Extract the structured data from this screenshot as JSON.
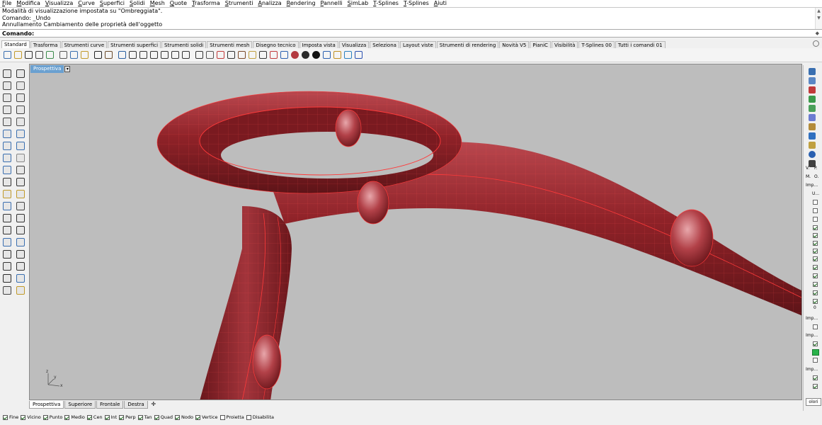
{
  "menu": [
    "File",
    "Modifica",
    "Visualizza",
    "Curve",
    "Superfici",
    "Solidi",
    "Mesh",
    "Quote",
    "Trasforma",
    "Strumenti",
    "Analizza",
    "Rendering",
    "Pannelli",
    "SimLab",
    "T-Splines",
    "T-Splines",
    "Aiuti"
  ],
  "history": [
    "Modalità di visualizzazione impostata su \"Ombreggiata\".",
    "Comando: _Undo",
    "Annullamento Cambiamento delle proprietà dell'oggetto"
  ],
  "command": {
    "label": "Comando:",
    "value": ""
  },
  "tabs": [
    "Standard",
    "Trasforma",
    "Strumenti curve",
    "Strumenti superfici",
    "Strumenti solidi",
    "Strumenti mesh",
    "Disegno tecnico",
    "Imposta vista",
    "Visualizza",
    "Seleziona",
    "Layout viste",
    "Strumenti di rendering",
    "Novità V5",
    "PianiC",
    "Visibilità",
    "T-Splines 00",
    "Tutti i comandi 01"
  ],
  "active_tab": "Standard",
  "toolbar_icons": [
    "new-file-icon",
    "open-file-icon",
    "save-icon",
    "print-icon",
    "import-icon",
    "cut-icon",
    "copy-icon",
    "paste-icon",
    "undo-icon",
    "pan-hand-icon",
    "rotate-view-icon",
    "zoom-icon",
    "zoom-window-icon",
    "zoom-extents-icon",
    "zoom-selected-icon",
    "zoom-all-icon",
    "four-views-icon",
    "cplane-icon",
    "show-icon",
    "hide-icon",
    "lock-icon",
    "layer-icon",
    "light-icon",
    "lock-object-icon",
    "material-icon",
    "render-icon",
    "rendered-sphere-icon",
    "shaded-sphere-icon",
    "dark-sphere-icon",
    "object-props-icon",
    "options-gear-icon",
    "grid-snap-icon",
    "help-icon"
  ],
  "left_tools": [
    "select-arrow-icon",
    "point-icon",
    "polyline-icon",
    "curve-control-icon",
    "circle-icon",
    "arc-icon",
    "rectangle-icon",
    "polygon-icon",
    "ellipse-icon",
    "free-curve-icon",
    "surface-corners-icon",
    "surface-edge-icon",
    "sphere-solid-icon",
    "box-solid-icon",
    "mesh-icon",
    "mesh-sphere-icon",
    "offset-icon",
    "fillet-icon",
    "trim-icon",
    "split-icon",
    "boolean-union-icon",
    "boolean-diff-icon",
    "explode-icon",
    "join-icon",
    "move-icon",
    "scale-icon",
    "array-icon",
    "mirror-icon",
    "group-icon",
    "ungroup-icon",
    "dimension-icon",
    "dimension-angle-icon",
    "block-icon",
    "text-icon",
    "check-icon",
    "analyze-icon",
    "render-light-icon",
    "paint-icon"
  ],
  "viewport": {
    "name": "Prospettiva",
    "axis_z": "z",
    "axis_y": "y",
    "axis_x": "x"
  },
  "viewport_tabs": [
    "Prospettiva",
    "Superiore",
    "Frontale",
    "Destra"
  ],
  "osnaps": [
    {
      "label": "Fine",
      "on": true
    },
    {
      "label": "Vicino",
      "on": true
    },
    {
      "label": "Punto",
      "on": true
    },
    {
      "label": "Medio",
      "on": true
    },
    {
      "label": "Cen",
      "on": true
    },
    {
      "label": "Int",
      "on": true
    },
    {
      "label": "Perp",
      "on": true
    },
    {
      "label": "Tan",
      "on": true
    },
    {
      "label": "Quad",
      "on": true
    },
    {
      "label": "Nodo",
      "on": true
    },
    {
      "label": "Vertice",
      "on": true
    },
    {
      "label": "Proietta",
      "on": false
    },
    {
      "label": "Disabilita",
      "on": false
    }
  ],
  "right_panel": {
    "labels": [
      "V.",
      "P.",
      "M.",
      "O.",
      "Imp...",
      "Imp...",
      "Imp...",
      "Imp..."
    ],
    "color_button": "olori",
    "zero": "0",
    "letters": [
      "U..."
    ]
  },
  "colors": {
    "model": "#9a2a30",
    "edge": "#ff3a3a",
    "viewport_bg": "#bdbdbd",
    "title_bg": "#6aa0d0"
  }
}
